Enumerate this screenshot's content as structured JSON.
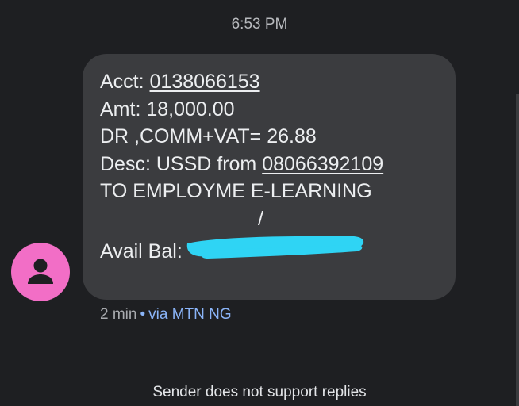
{
  "header": {
    "time": "6:53 PM"
  },
  "message": {
    "acct_label": "Acct: ",
    "acct_number": "0138066153",
    "amt_line": "Amt: 18,000.00",
    "charge_line": "DR ,COMM+VAT= 26.88",
    "desc_label": "Desc: USSD from ",
    "desc_phone": "08066392109",
    "to_line": "TO EMPLOYME E-LEARNING",
    "slash": "/",
    "avail_label": "Avail Bal:"
  },
  "meta": {
    "age": "2 min",
    "separator": "•",
    "via": "via MTN NG"
  },
  "footer": {
    "notice": "Sender does not support replies"
  },
  "colors": {
    "background": "#1e1f22",
    "bubble": "#3b3c3f",
    "avatar": "#f26ec6",
    "redaction": "#2fd4f4",
    "link_blue": "#8ab4f8"
  },
  "icons": {
    "avatar": "person-icon"
  }
}
